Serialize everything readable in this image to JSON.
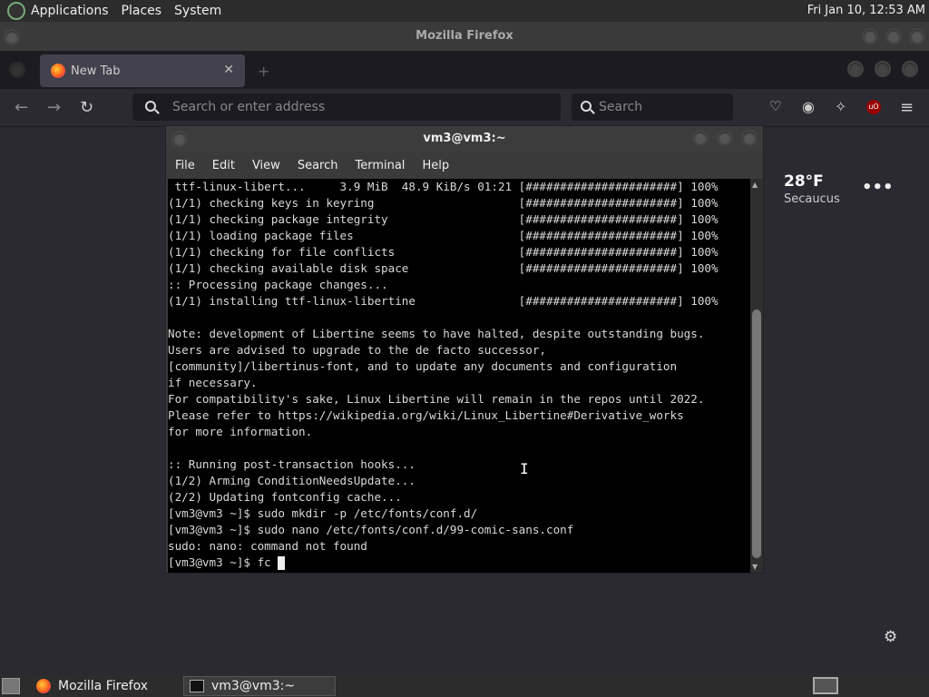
{
  "topbar": {
    "menus": [
      "Applications",
      "Places",
      "System"
    ],
    "clock": "Fri Jan 10, 12:53 AM"
  },
  "firefox": {
    "window_title": "Mozilla Firefox",
    "tab_label": "New Tab",
    "tab_close": "✕",
    "new_tab_symbol": "+",
    "address_placeholder": "Search or enter address",
    "search_placeholder": "Search"
  },
  "newtab_page": {
    "temperature": "28°F",
    "city": "Secaucus",
    "more": "•••",
    "settings": "⚙"
  },
  "terminal": {
    "title": "vm3@vm3:~",
    "menu": [
      "File",
      "Edit",
      "View",
      "Search",
      "Terminal",
      "Help"
    ],
    "lines": [
      " ttf-linux-libert...     3.9 MiB  48.9 KiB/s 01:21 [######################] 100%",
      "(1/1) checking keys in keyring                     [######################] 100%",
      "(1/1) checking package integrity                   [######################] 100%",
      "(1/1) loading package files                        [######################] 100%",
      "(1/1) checking for file conflicts                  [######################] 100%",
      "(1/1) checking available disk space                [######################] 100%",
      ":: Processing package changes...",
      "(1/1) installing ttf-linux-libertine               [######################] 100%",
      "",
      "Note: development of Libertine seems to have halted, despite outstanding bugs.",
      "Users are advised to upgrade to the de facto successor,",
      "[community]/libertinus-font, and to update any documents and configuration",
      "if necessary.",
      "For compatibility's sake, Linux Libertine will remain in the repos until 2022.",
      "Please refer to https://wikipedia.org/wiki/Linux_Libertine#Derivative_works",
      "for more information.",
      "",
      ":: Running post-transaction hooks...",
      "(1/2) Arming ConditionNeedsUpdate...",
      "(2/2) Updating fontconfig cache...",
      "[vm3@vm3 ~]$ sudo mkdir -p /etc/fonts/conf.d/",
      "[vm3@vm3 ~]$ sudo nano /etc/fonts/conf.d/99-comic-sans.conf",
      "sudo: nano: command not found"
    ],
    "prompt": "[vm3@vm3 ~]$ fc "
  },
  "taskbar": {
    "firefox_label": "Mozilla Firefox",
    "terminal_label": "vm3@vm3:~"
  }
}
